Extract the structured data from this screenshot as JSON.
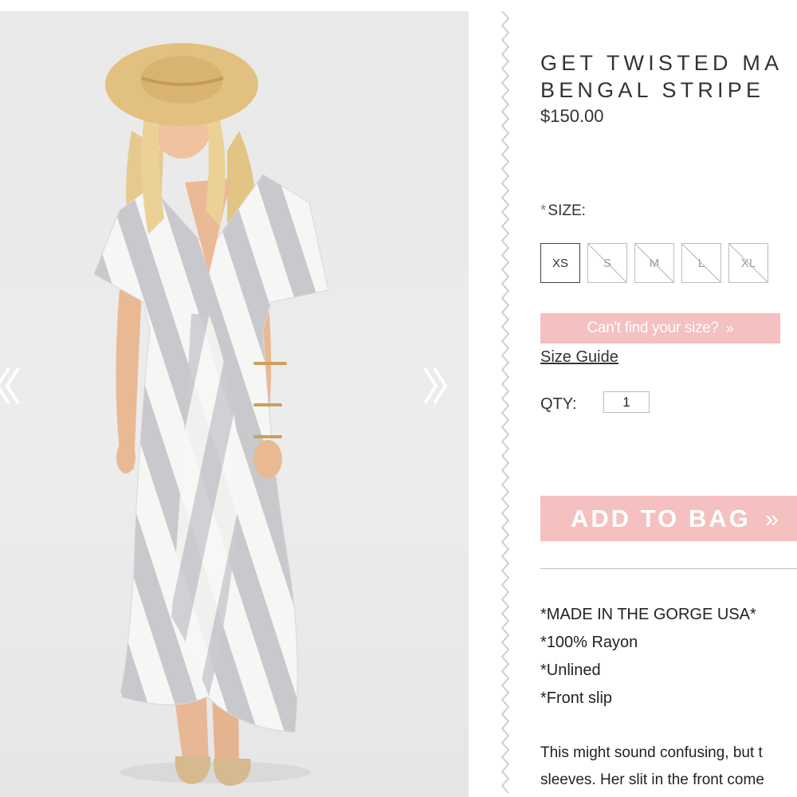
{
  "gallery": {
    "prev_icon": "double-chevron-left-icon",
    "next_icon": "double-chevron-right-icon"
  },
  "product": {
    "title_line1": "GET TWISTED MA",
    "title_line2": "BENGAL STRIPE",
    "price": "$150.00"
  },
  "size": {
    "required_mark": "*",
    "label": "SIZE:",
    "options": [
      {
        "label": "XS",
        "available": true
      },
      {
        "label": "S",
        "available": false
      },
      {
        "label": "M",
        "available": false
      },
      {
        "label": "L",
        "available": false
      },
      {
        "label": "XL",
        "available": false
      }
    ],
    "cant_find_label": "Can't find your size?",
    "cant_find_icon": "»",
    "guide_label": "Size Guide"
  },
  "quantity": {
    "label": "QTY:",
    "value": "1"
  },
  "cart": {
    "add_label": "ADD TO BAG",
    "add_icon": "»"
  },
  "details": {
    "features": [
      "*MADE IN THE GORGE USA*",
      "*100% Rayon",
      "*Unlined",
      "*Front slip"
    ],
    "description_line1": "This might sound confusing, but t",
    "description_line2": "sleeves. Her slit in the front come"
  },
  "colors": {
    "accent_pink": "#f4c0c0",
    "required_blue": "#4a90c0",
    "dress_stripe": "#c9c9cd"
  }
}
